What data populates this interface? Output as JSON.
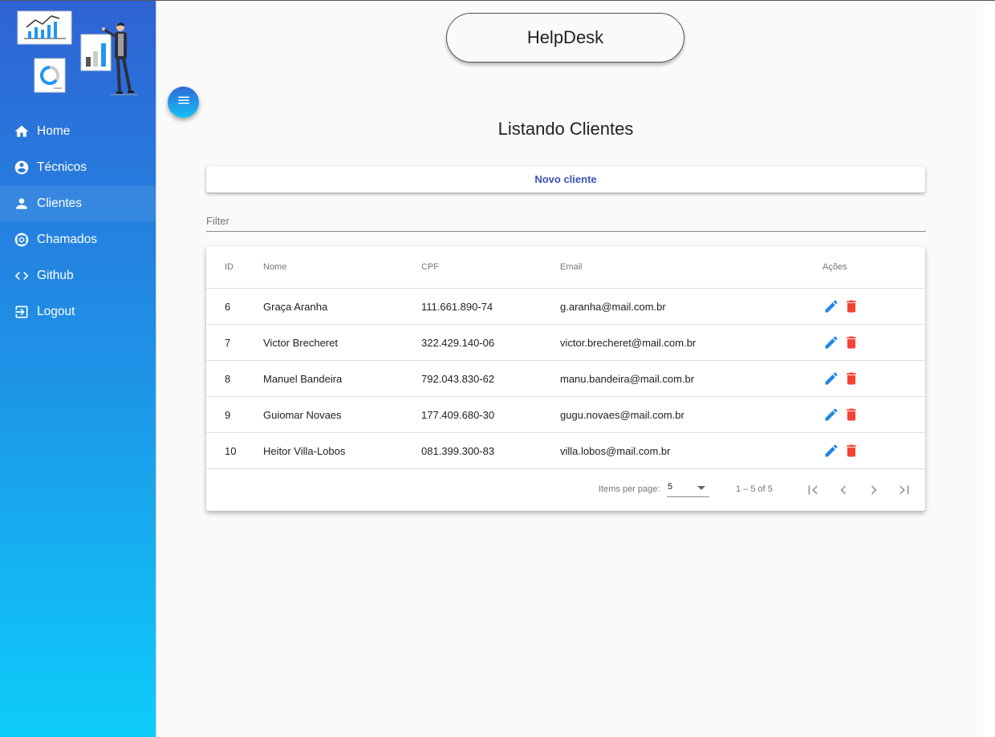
{
  "app": {
    "title": "HelpDesk"
  },
  "sidebar": {
    "items": [
      {
        "label": "Home",
        "icon": "home-icon",
        "active": false
      },
      {
        "label": "Técnicos",
        "icon": "account-circle-icon",
        "active": false
      },
      {
        "label": "Clientes",
        "icon": "person-icon",
        "active": true
      },
      {
        "label": "Chamados",
        "icon": "lifebuoy-icon",
        "active": false
      },
      {
        "label": "Github",
        "icon": "code-icon",
        "active": false
      },
      {
        "label": "Logout",
        "icon": "logout-icon",
        "active": false
      }
    ]
  },
  "page": {
    "title": "Listando Clientes",
    "new_button": "Novo cliente",
    "filter_placeholder": "Filter"
  },
  "table": {
    "headers": {
      "id": "ID",
      "nome": "Nome",
      "cpf": "CPF",
      "email": "Email",
      "acoes": "Ações"
    },
    "rows": [
      {
        "id": "6",
        "nome": "Graça Aranha",
        "cpf": "111.661.890-74",
        "email": "g.aranha@mail.com.br"
      },
      {
        "id": "7",
        "nome": "Victor Brecheret",
        "cpf": "322.429.140-06",
        "email": "victor.brecheret@mail.com.br"
      },
      {
        "id": "8",
        "nome": "Manuel Bandeira",
        "cpf": "792.043.830-62",
        "email": "manu.bandeira@mail.com.br"
      },
      {
        "id": "9",
        "nome": "Guiomar Novaes",
        "cpf": "177.409.680-30",
        "email": "gugu.novaes@mail.com.br"
      },
      {
        "id": "10",
        "nome": "Heitor Villa-Lobos",
        "cpf": "081.399.300-83",
        "email": "villa.lobos@mail.com.br"
      }
    ]
  },
  "paginator": {
    "items_per_page_label": "Items per page:",
    "page_size": "5",
    "range": "1 – 5 of 5"
  },
  "colors": {
    "sidebar_top": "#2f63d4",
    "sidebar_bottom": "#0dcdfb",
    "accent": "#3f51b5",
    "edit_icon": "#1e88e5",
    "delete_icon": "#f44336"
  }
}
